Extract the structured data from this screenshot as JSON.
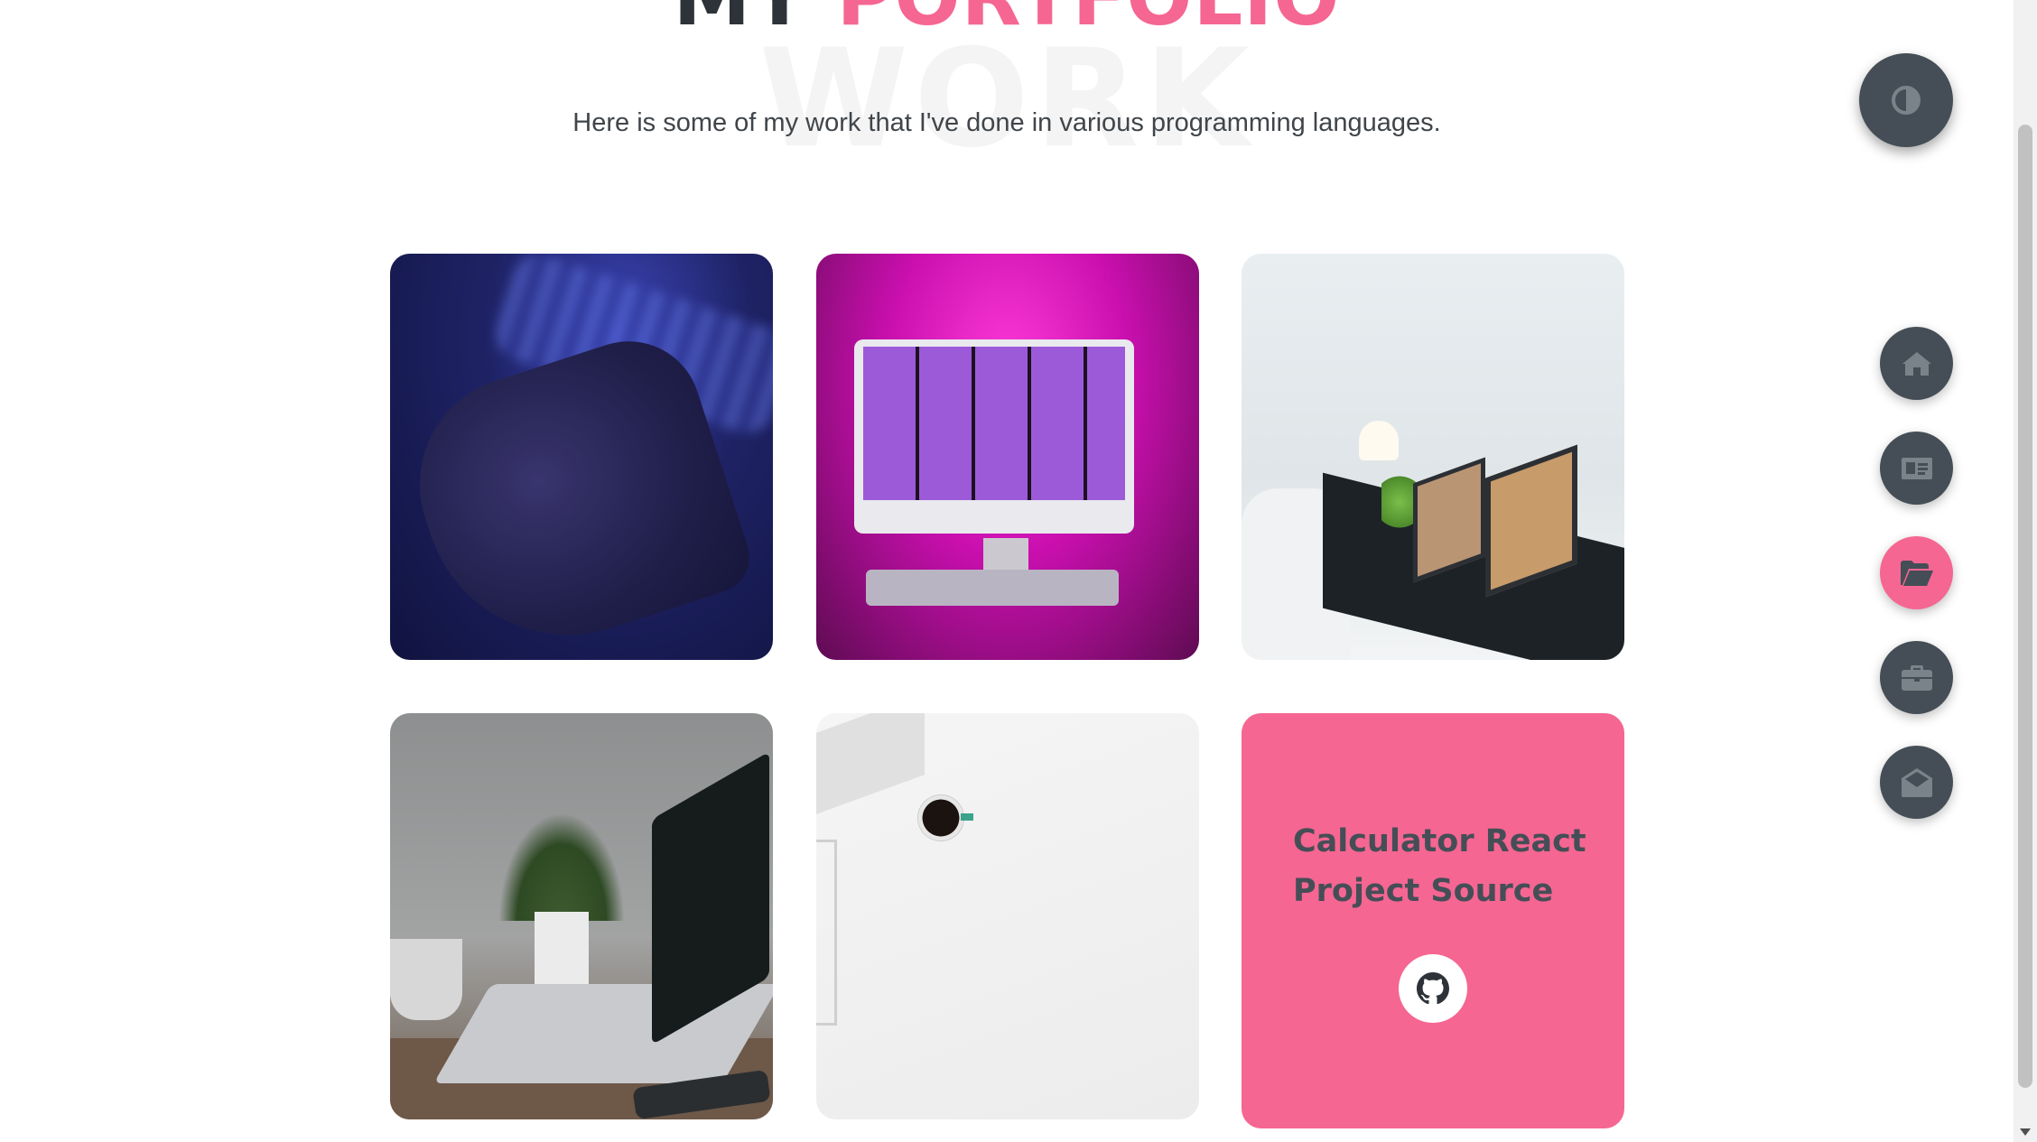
{
  "section": {
    "heading_first": "MY",
    "heading_accent": "PORTFOLIO",
    "background_word": "WORK",
    "subtitle": "Here is some of my work that I've done in various programming languages."
  },
  "portfolio": {
    "items": [
      {
        "image": "hand-on-keyboard-photo"
      },
      {
        "image": "pink-desktop-setup-photo"
      },
      {
        "image": "white-desk-laptops-photo"
      },
      {
        "image": "laptop-and-plant-photo"
      },
      {
        "image": "coffee-cup-flatlay-photo"
      },
      {
        "overlay_title": "Calculator React Project Source",
        "icon": "github-icon"
      }
    ]
  },
  "nav": {
    "theme_toggle_icon": "contrast-icon",
    "items": [
      {
        "icon": "home-icon"
      },
      {
        "icon": "id-card-icon"
      },
      {
        "icon": "folder-open-icon",
        "active": true
      },
      {
        "icon": "briefcase-icon"
      },
      {
        "icon": "envelope-open-icon"
      }
    ]
  },
  "colors": {
    "accent": "#f56692",
    "dark": "#454e56"
  }
}
